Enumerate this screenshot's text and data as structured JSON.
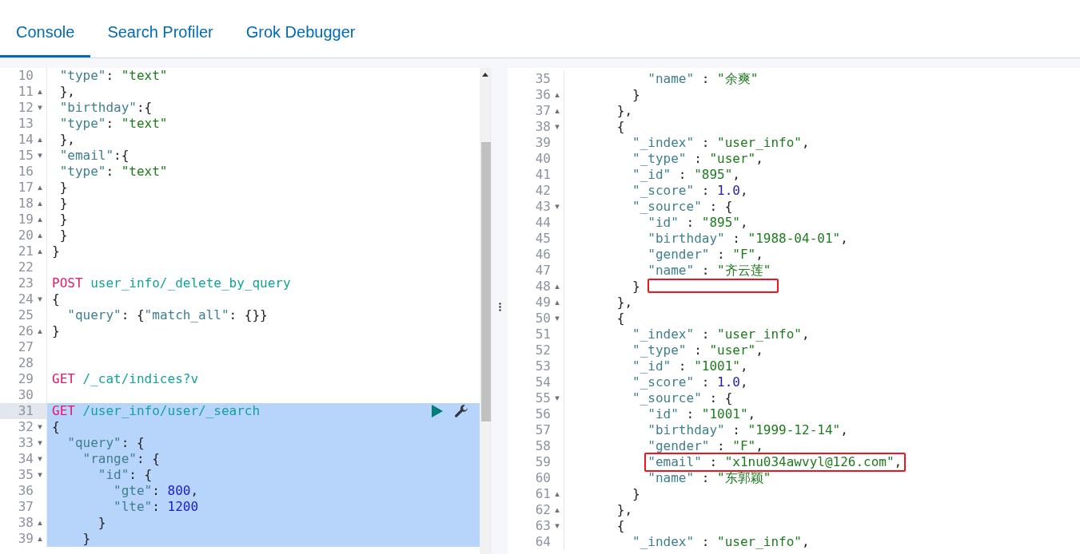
{
  "tabs": [
    {
      "label": "Console",
      "selected": true
    },
    {
      "label": "Search Profiler",
      "selected": false
    },
    {
      "label": "Grok Debugger",
      "selected": false
    }
  ],
  "request_editor": {
    "lines": [
      {
        "number": "10",
        "selected": false,
        "tokens": [
          {
            "kind": "key",
            "text": " \"type\""
          },
          {
            "kind": "punct",
            "text": ": "
          },
          {
            "kind": "string",
            "text": "\"text\""
          }
        ]
      },
      {
        "number": "11",
        "selected": false,
        "fold": "▴",
        "tokens": [
          {
            "kind": "punct",
            "text": " },"
          }
        ]
      },
      {
        "number": "12",
        "selected": false,
        "fold": "▾",
        "tokens": [
          {
            "kind": "key",
            "text": " \"birthday\""
          },
          {
            "kind": "punct",
            "text": ":{"
          }
        ]
      },
      {
        "number": "13",
        "selected": false,
        "tokens": [
          {
            "kind": "key",
            "text": " \"type\""
          },
          {
            "kind": "punct",
            "text": ": "
          },
          {
            "kind": "string",
            "text": "\"text\""
          }
        ]
      },
      {
        "number": "14",
        "selected": false,
        "fold": "▴",
        "tokens": [
          {
            "kind": "punct",
            "text": " },"
          }
        ]
      },
      {
        "number": "15",
        "selected": false,
        "fold": "▾",
        "tokens": [
          {
            "kind": "key",
            "text": " \"email\""
          },
          {
            "kind": "punct",
            "text": ":{"
          }
        ]
      },
      {
        "number": "16",
        "selected": false,
        "tokens": [
          {
            "kind": "key",
            "text": " \"type\""
          },
          {
            "kind": "punct",
            "text": ": "
          },
          {
            "kind": "string",
            "text": "\"text\""
          }
        ]
      },
      {
        "number": "17",
        "selected": false,
        "fold": "▴",
        "tokens": [
          {
            "kind": "punct",
            "text": " }"
          }
        ]
      },
      {
        "number": "18",
        "selected": false,
        "fold": "▴",
        "tokens": [
          {
            "kind": "punct",
            "text": " }"
          }
        ]
      },
      {
        "number": "19",
        "selected": false,
        "fold": "▴",
        "tokens": [
          {
            "kind": "punct",
            "text": " }"
          }
        ]
      },
      {
        "number": "20",
        "selected": false,
        "fold": "▴",
        "tokens": [
          {
            "kind": "punct",
            "text": " }"
          }
        ]
      },
      {
        "number": "21",
        "selected": false,
        "fold": "▴",
        "tokens": [
          {
            "kind": "punct",
            "text": "}"
          }
        ]
      },
      {
        "number": "22",
        "selected": false
      },
      {
        "number": "23",
        "selected": false,
        "tokens": [
          {
            "kind": "method",
            "text": "POST"
          },
          {
            "kind": "url",
            "text": " user_info/_delete_by_query"
          }
        ]
      },
      {
        "number": "24",
        "selected": false,
        "fold": "▾",
        "tokens": [
          {
            "kind": "punct",
            "text": "{"
          }
        ]
      },
      {
        "number": "25",
        "selected": false,
        "tokens": [
          {
            "kind": "key",
            "text": "  \"query\""
          },
          {
            "kind": "punct",
            "text": ": {"
          },
          {
            "kind": "key",
            "text": "\"match_all\""
          },
          {
            "kind": "punct",
            "text": ": {}}"
          }
        ]
      },
      {
        "number": "26",
        "selected": false,
        "fold": "▴",
        "tokens": [
          {
            "kind": "punct",
            "text": "}"
          }
        ]
      },
      {
        "number": "27",
        "selected": false
      },
      {
        "number": "28",
        "selected": false
      },
      {
        "number": "29",
        "selected": false,
        "tokens": [
          {
            "kind": "method",
            "text": "GET"
          },
          {
            "kind": "url",
            "text": " /_cat/indices?v"
          }
        ]
      },
      {
        "number": "30",
        "selected": false
      },
      {
        "number": "31",
        "selected": true,
        "active": true,
        "actions": true,
        "tokens": [
          {
            "kind": "method",
            "text": "GET"
          },
          {
            "kind": "url",
            "text": " /user_info/user/_search"
          }
        ]
      },
      {
        "number": "32",
        "selected": true,
        "fold": "▾",
        "tokens": [
          {
            "kind": "punct",
            "text": "{"
          }
        ]
      },
      {
        "number": "33",
        "selected": true,
        "fold": "▾",
        "tokens": [
          {
            "kind": "key",
            "text": "  \"query\""
          },
          {
            "kind": "punct",
            "text": ": {"
          }
        ]
      },
      {
        "number": "34",
        "selected": true,
        "fold": "▾",
        "tokens": [
          {
            "kind": "key",
            "text": "    \"range\""
          },
          {
            "kind": "punct",
            "text": ": {"
          }
        ]
      },
      {
        "number": "35",
        "selected": true,
        "fold": "▾",
        "tokens": [
          {
            "kind": "key",
            "text": "      \"id\""
          },
          {
            "kind": "punct",
            "text": ": {"
          }
        ]
      },
      {
        "number": "36",
        "selected": true,
        "tokens": [
          {
            "kind": "key",
            "text": "        \"gte\""
          },
          {
            "kind": "punct",
            "text": ": "
          },
          {
            "kind": "number",
            "text": "800"
          },
          {
            "kind": "punct",
            "text": ","
          }
        ]
      },
      {
        "number": "37",
        "selected": true,
        "tokens": [
          {
            "kind": "key",
            "text": "        \"lte\""
          },
          {
            "kind": "punct",
            "text": ": "
          },
          {
            "kind": "number",
            "text": "1200"
          }
        ]
      },
      {
        "number": "38",
        "selected": true,
        "fold": "▴",
        "tokens": [
          {
            "kind": "punct",
            "text": "      }"
          }
        ]
      },
      {
        "number": "39",
        "selected": true,
        "fold": "▴",
        "tokens": [
          {
            "kind": "punct",
            "text": "    }"
          }
        ]
      }
    ]
  },
  "response_viewer": {
    "lines": [
      {
        "number": "35",
        "tokens": [
          {
            "kind": "key",
            "text": "          \"name\""
          },
          {
            "kind": "punct",
            "text": " : "
          },
          {
            "kind": "string",
            "text": "\"余爽\""
          }
        ]
      },
      {
        "number": "36",
        "fold": "▴",
        "tokens": [
          {
            "kind": "punct",
            "text": "        }"
          }
        ]
      },
      {
        "number": "37",
        "fold": "▴",
        "tokens": [
          {
            "kind": "punct",
            "text": "      },"
          }
        ]
      },
      {
        "number": "38",
        "fold": "▾",
        "tokens": [
          {
            "kind": "punct",
            "text": "      {"
          }
        ]
      },
      {
        "number": "39",
        "tokens": [
          {
            "kind": "key",
            "text": "        \"_index\""
          },
          {
            "kind": "punct",
            "text": " : "
          },
          {
            "kind": "string",
            "text": "\"user_info\""
          },
          {
            "kind": "punct",
            "text": ","
          }
        ]
      },
      {
        "number": "40",
        "tokens": [
          {
            "kind": "key",
            "text": "        \"_type\""
          },
          {
            "kind": "punct",
            "text": " : "
          },
          {
            "kind": "string",
            "text": "\"user\""
          },
          {
            "kind": "punct",
            "text": ","
          }
        ]
      },
      {
        "number": "41",
        "tokens": [
          {
            "kind": "key",
            "text": "        \"_id\""
          },
          {
            "kind": "punct",
            "text": " : "
          },
          {
            "kind": "string",
            "text": "\"895\""
          },
          {
            "kind": "punct",
            "text": ","
          }
        ]
      },
      {
        "number": "42",
        "tokens": [
          {
            "kind": "key",
            "text": "        \"_score\""
          },
          {
            "kind": "punct",
            "text": " : "
          },
          {
            "kind": "number",
            "text": "1.0"
          },
          {
            "kind": "punct",
            "text": ","
          }
        ]
      },
      {
        "number": "43",
        "fold": "▾",
        "tokens": [
          {
            "kind": "key",
            "text": "        \"_source\""
          },
          {
            "kind": "punct",
            "text": " : {"
          }
        ]
      },
      {
        "number": "44",
        "tokens": [
          {
            "kind": "key",
            "text": "          \"id\""
          },
          {
            "kind": "punct",
            "text": " : "
          },
          {
            "kind": "string",
            "text": "\"895\""
          },
          {
            "kind": "punct",
            "text": ","
          }
        ]
      },
      {
        "number": "45",
        "tokens": [
          {
            "kind": "key",
            "text": "          \"birthday\""
          },
          {
            "kind": "punct",
            "text": " : "
          },
          {
            "kind": "string",
            "text": "\"1988-04-01\""
          },
          {
            "kind": "punct",
            "text": ","
          }
        ]
      },
      {
        "number": "46",
        "tokens": [
          {
            "kind": "key",
            "text": "          \"gender\""
          },
          {
            "kind": "punct",
            "text": " : "
          },
          {
            "kind": "string",
            "text": "\"F\""
          },
          {
            "kind": "punct",
            "text": ","
          }
        ]
      },
      {
        "number": "47",
        "tokens": [
          {
            "kind": "key",
            "text": "          \"name\""
          },
          {
            "kind": "punct",
            "text": " : "
          },
          {
            "kind": "string",
            "text": "\"齐云莲\""
          }
        ]
      },
      {
        "number": "48",
        "fold": "▴",
        "box_after": true,
        "tokens": [
          {
            "kind": "punct",
            "text": "        }"
          }
        ]
      },
      {
        "number": "49",
        "fold": "▴",
        "tokens": [
          {
            "kind": "punct",
            "text": "      },"
          }
        ]
      },
      {
        "number": "50",
        "fold": "▾",
        "tokens": [
          {
            "kind": "punct",
            "text": "      {"
          }
        ]
      },
      {
        "number": "51",
        "tokens": [
          {
            "kind": "key",
            "text": "        \"_index\""
          },
          {
            "kind": "punct",
            "text": " : "
          },
          {
            "kind": "string",
            "text": "\"user_info\""
          },
          {
            "kind": "punct",
            "text": ","
          }
        ]
      },
      {
        "number": "52",
        "tokens": [
          {
            "kind": "key",
            "text": "        \"_type\""
          },
          {
            "kind": "punct",
            "text": " : "
          },
          {
            "kind": "string",
            "text": "\"user\""
          },
          {
            "kind": "punct",
            "text": ","
          }
        ]
      },
      {
        "number": "53",
        "tokens": [
          {
            "kind": "key",
            "text": "        \"_id\""
          },
          {
            "kind": "punct",
            "text": " : "
          },
          {
            "kind": "string",
            "text": "\"1001\""
          },
          {
            "kind": "punct",
            "text": ","
          }
        ]
      },
      {
        "number": "54",
        "tokens": [
          {
            "kind": "key",
            "text": "        \"_score\""
          },
          {
            "kind": "punct",
            "text": " : "
          },
          {
            "kind": "number",
            "text": "1.0"
          },
          {
            "kind": "punct",
            "text": ","
          }
        ]
      },
      {
        "number": "55",
        "fold": "▾",
        "tokens": [
          {
            "kind": "key",
            "text": "        \"_source\""
          },
          {
            "kind": "punct",
            "text": " : {"
          }
        ]
      },
      {
        "number": "56",
        "tokens": [
          {
            "kind": "key",
            "text": "          \"id\""
          },
          {
            "kind": "punct",
            "text": " : "
          },
          {
            "kind": "string",
            "text": "\"1001\""
          },
          {
            "kind": "punct",
            "text": ","
          }
        ]
      },
      {
        "number": "57",
        "tokens": [
          {
            "kind": "key",
            "text": "          \"birthday\""
          },
          {
            "kind": "punct",
            "text": " : "
          },
          {
            "kind": "string",
            "text": "\"1999-12-14\""
          },
          {
            "kind": "punct",
            "text": ","
          }
        ]
      },
      {
        "number": "58",
        "tokens": [
          {
            "kind": "key",
            "text": "          \"gender\""
          },
          {
            "kind": "punct",
            "text": " : "
          },
          {
            "kind": "string",
            "text": "\"F\""
          },
          {
            "kind": "punct",
            "text": ","
          }
        ]
      },
      {
        "number": "59",
        "boxed": true,
        "tokens": [
          {
            "kind": "key",
            "text": "          \"email\""
          },
          {
            "kind": "punct",
            "text": " : "
          },
          {
            "kind": "string",
            "text": "\"x1nu034awvyl@126.com\""
          },
          {
            "kind": "punct",
            "text": ","
          }
        ]
      },
      {
        "number": "60",
        "tokens": [
          {
            "kind": "key",
            "text": "          \"name\""
          },
          {
            "kind": "punct",
            "text": " : "
          },
          {
            "kind": "string",
            "text": "\"东郭颖\""
          }
        ]
      },
      {
        "number": "61",
        "fold": "▴",
        "tokens": [
          {
            "kind": "punct",
            "text": "        }"
          }
        ]
      },
      {
        "number": "62",
        "fold": "▴",
        "tokens": [
          {
            "kind": "punct",
            "text": "      },"
          }
        ]
      },
      {
        "number": "63",
        "fold": "▾",
        "tokens": [
          {
            "kind": "punct",
            "text": "      {"
          }
        ]
      },
      {
        "number": "64",
        "tokens": [
          {
            "kind": "key",
            "text": "        \"_index\""
          },
          {
            "kind": "punct",
            "text": " : "
          },
          {
            "kind": "string",
            "text": "\"user_info\""
          },
          {
            "kind": "punct",
            "text": ","
          }
        ]
      }
    ]
  }
}
